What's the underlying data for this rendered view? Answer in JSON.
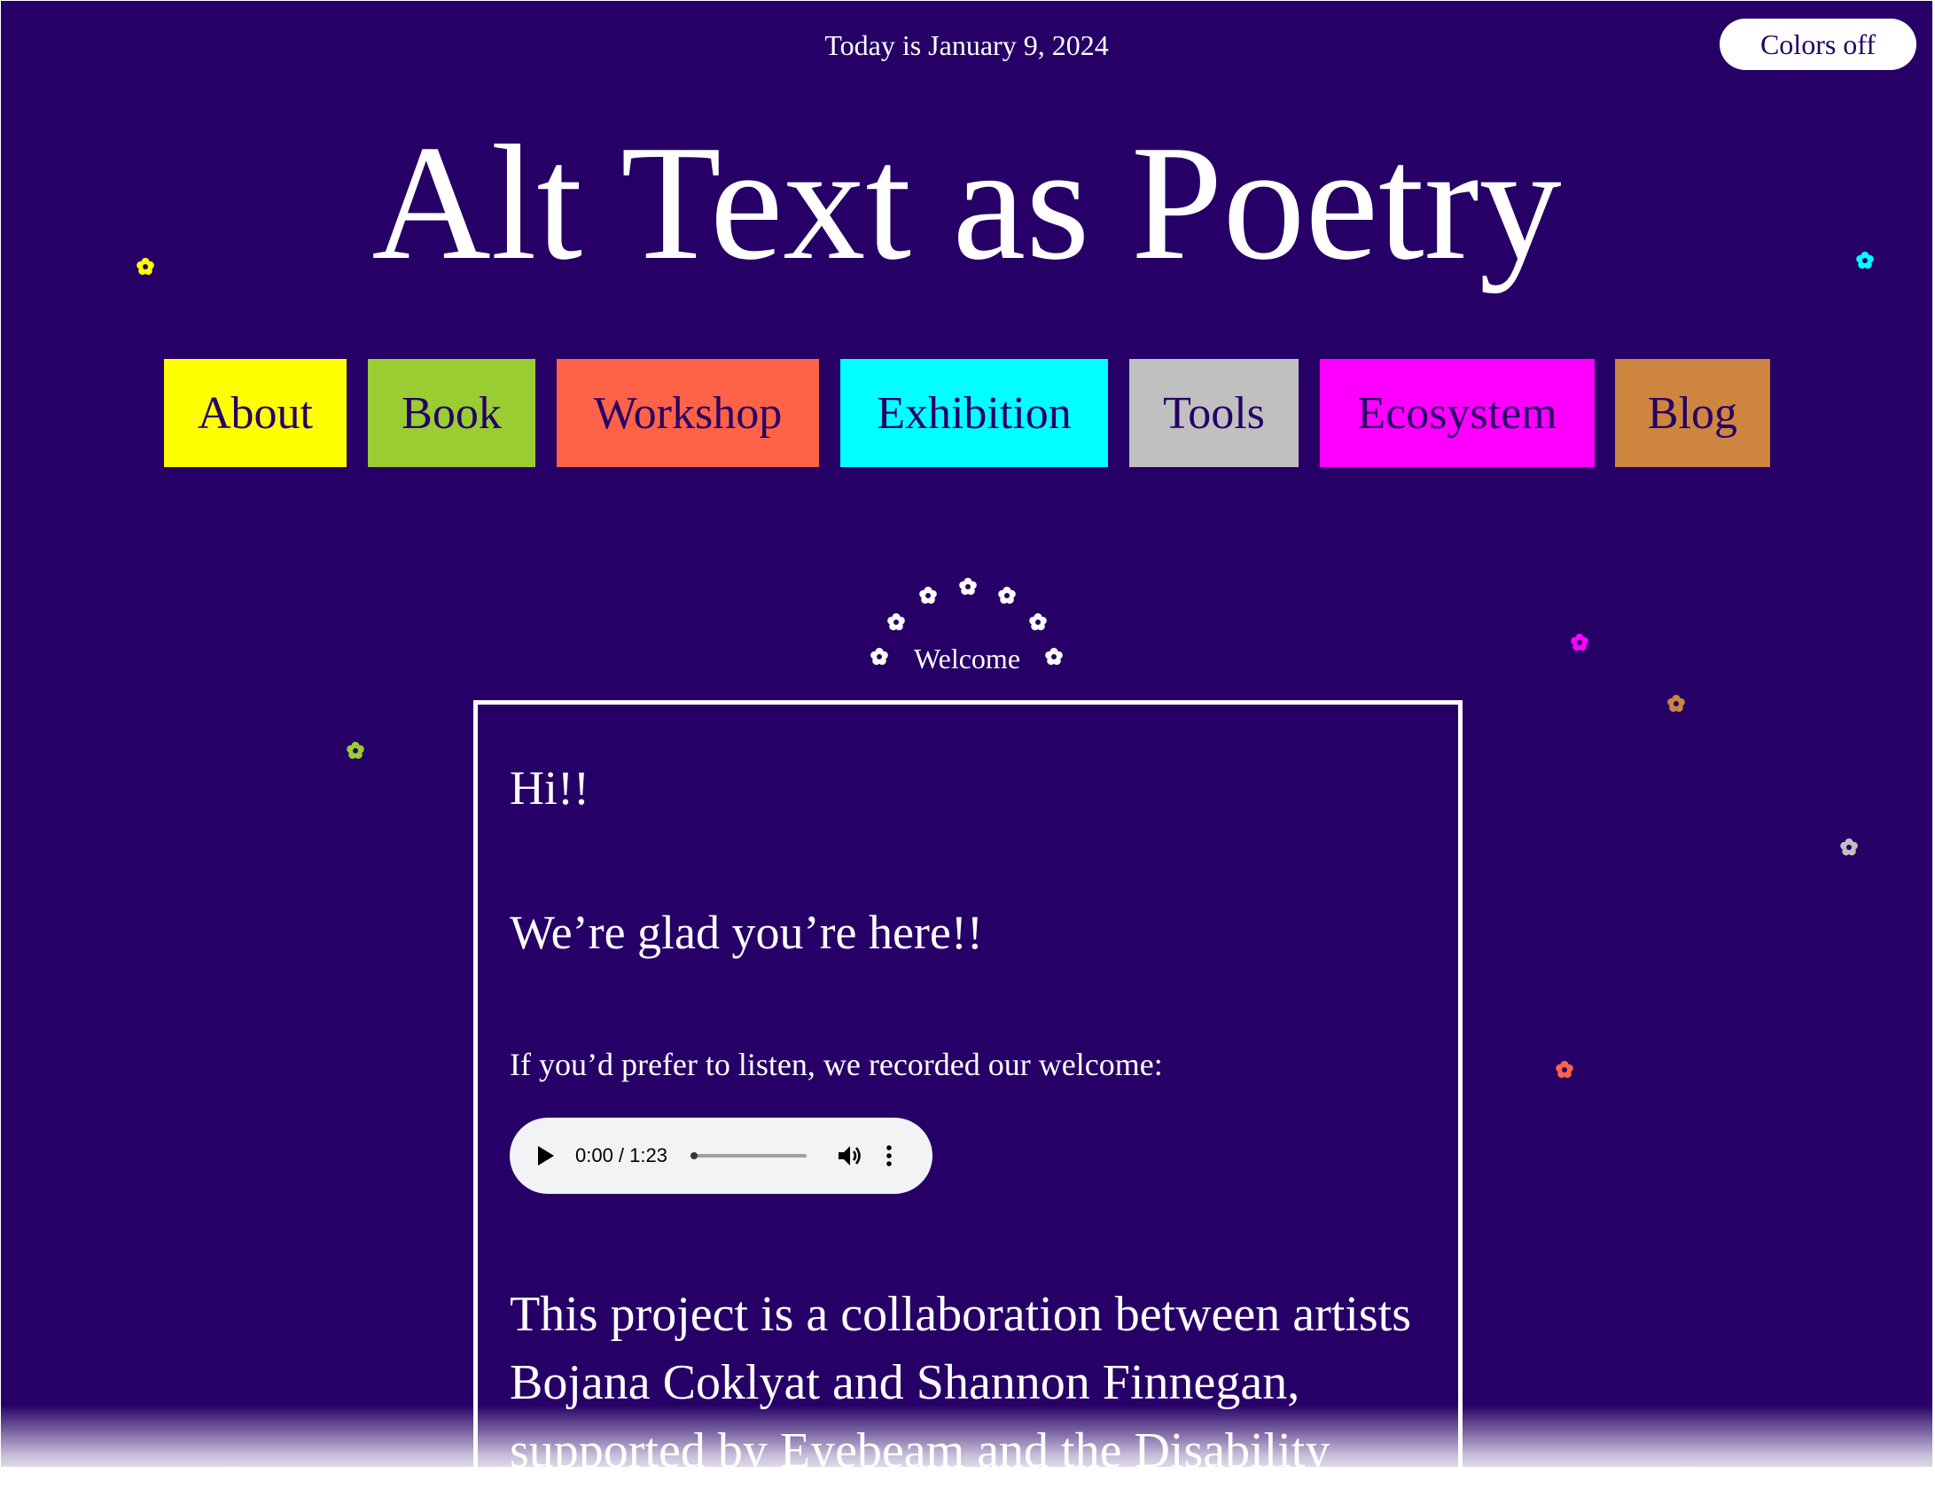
{
  "date_text": "Today is January 9, 2024",
  "colors_toggle_label": "Colors off",
  "site_title": "Alt Text as Poetry",
  "nav": [
    {
      "label": "About",
      "color": "#ffff00"
    },
    {
      "label": "Book",
      "color": "#9acd32"
    },
    {
      "label": "Workshop",
      "color": "#ff6347"
    },
    {
      "label": "Exhibition",
      "color": "#00ffff"
    },
    {
      "label": "Tools",
      "color": "#c0c0c0"
    },
    {
      "label": "Ecosystem",
      "color": "#ff00ff"
    },
    {
      "label": "Blog",
      "color": "#cd853f"
    }
  ],
  "section_heading": "Welcome",
  "welcome": {
    "greeting": "Hi!!",
    "glad": "We’re glad you’re here!!",
    "listen_prompt": "If you’d prefer to listen, we recorded our welcome:",
    "audio": {
      "time": "0:00 / 1:23",
      "progress": 0
    },
    "intro": "This project is a collaboration between artists Bojana Coklyat and Shannon Finnegan, supported by Eyebeam and the Disability"
  },
  "icons": {
    "flower": "flower-icon",
    "play": "play-icon",
    "volume": "volume-icon",
    "more": "more-options-icon"
  },
  "colors": {
    "background": "#260066",
    "text": "#ffffff"
  }
}
